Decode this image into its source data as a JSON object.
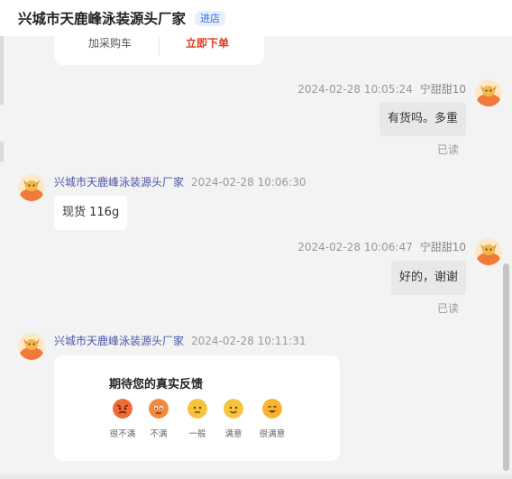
{
  "header": {
    "shop_name": "兴城市天鹿峰泳装源头厂家",
    "enter_store_label": "进店"
  },
  "order_card": {
    "add_cart_label": "加采购车",
    "buy_now_label": "立即下单"
  },
  "messages": [
    {
      "side": "right",
      "sender": "宁甜甜10",
      "time": "2024-02-28 10:05:24",
      "text": "有货吗。多重",
      "status": "已读"
    },
    {
      "side": "left",
      "sender": "兴城市天鹿峰泳装源头厂家",
      "time": "2024-02-28 10:06:30",
      "text": "现货 116g"
    },
    {
      "side": "right",
      "sender": "宁甜甜10",
      "time": "2024-02-28 10:06:47",
      "text": "好的，谢谢",
      "status": "已读"
    },
    {
      "side": "left",
      "sender": "兴城市天鹿峰泳装源头厂家",
      "time": "2024-02-28 10:11:31"
    }
  ],
  "feedback": {
    "title": "期待您的真实反馈",
    "options": [
      {
        "label": "很不满",
        "color": "#f26a35"
      },
      {
        "label": "不满",
        "color": "#f5893a"
      },
      {
        "label": "一般",
        "color": "#f7c33c"
      },
      {
        "label": "满意",
        "color": "#f7c33c"
      },
      {
        "label": "很满意",
        "color": "#f7b52f"
      }
    ]
  },
  "colors": {
    "accent_blue": "#2f6fe4",
    "sender_name": "#4a56a8",
    "buy_red": "#e4391b",
    "avatar_orange": "#f07a3a"
  }
}
